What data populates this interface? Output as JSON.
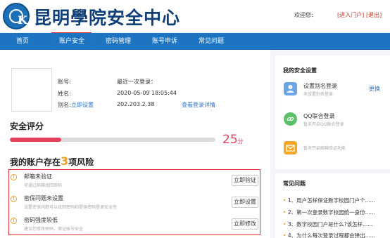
{
  "header": {
    "title": "昆明學院安全中心",
    "welcome": "欢迎您:",
    "enter_portal": "[进入门户]",
    "logout": "[退出]"
  },
  "nav": {
    "items": [
      "首页",
      "账户安全",
      "密码管理",
      "账号申诉",
      "常见问题"
    ],
    "selected": "账户安全"
  },
  "account": {
    "account_label": "账号:",
    "name_label": "姓名:",
    "alias_label": "别名:",
    "alias_link": "立即设置",
    "last_login_label": "最近一次登录：",
    "last_login_time": "2020-05-09 18:05:44",
    "last_login_ip": "202.203.2.38",
    "login_details_link": "查看登录详情"
  },
  "security": {
    "title": "安全评分",
    "score": 25,
    "score_unit": "分",
    "risk_prefix": "我的账户存在",
    "risk_count": "3",
    "risk_suffix": "项风险"
  },
  "risks": [
    {
      "title": "邮箱未验证",
      "desc": "可通过邮箱找回密码",
      "button": "立即验证"
    },
    {
      "title": "密保问题未设置",
      "desc": "设置密保问题可以找回密码和提供密码登录安全性",
      "button": "立即设置"
    },
    {
      "title": "密码强度较低",
      "desc": "建议您修改密码，保证账号安全",
      "button": "立即修改"
    }
  ],
  "sidebar": {
    "settings_title": "我的安全设置",
    "alias": {
      "title": "设置别名登录",
      "desc": "未设置别名登录",
      "action": "更换"
    },
    "qq": {
      "title": "QQ联合登录",
      "desc": "暂未开启QQ联合登录"
    },
    "mail": {
      "desc": "暂未开启邮箱验证功能"
    },
    "faq_title": "常见问题",
    "faq": [
      {
        "num": "1、",
        "text": "用户怎样保证数字校园门户个......"
      },
      {
        "num": "2、",
        "text": "第一次登录数字校园统一身份......"
      },
      {
        "num": "3、",
        "text": "数字校园门户是什么?该怎样......"
      },
      {
        "num": "4、",
        "text": "为什么每次登录过程都会弹出......"
      }
    ]
  },
  "colors": {
    "nav_blue": "#1d75c2",
    "score_red": "#e5405b",
    "risk_orange": "#f0a020",
    "highlight_red": "#e2313b",
    "link_blue": "#2f73c9"
  }
}
